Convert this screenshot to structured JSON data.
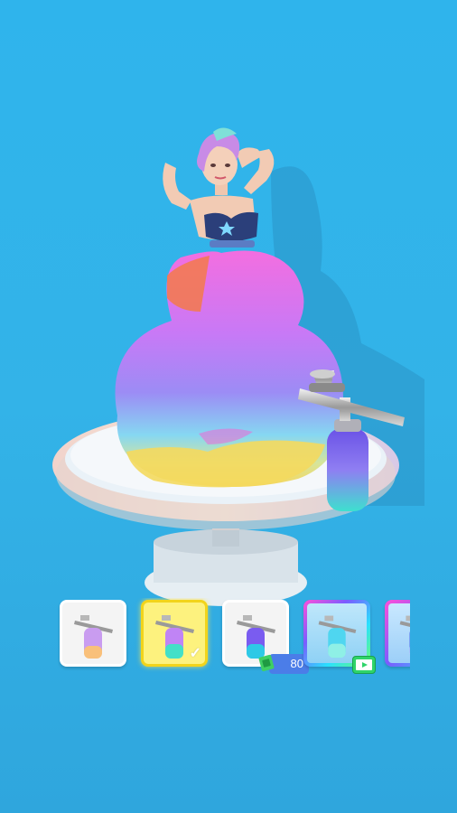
{
  "shop": {
    "items": [
      {
        "id": "spray-1",
        "state": "owned",
        "bottle_colors": [
          "#f9c07a",
          "#b97cf0"
        ]
      },
      {
        "id": "spray-2",
        "state": "selected",
        "bottle_colors": [
          "#c084f5",
          "#43e0c8"
        ]
      },
      {
        "id": "spray-3",
        "state": "locked",
        "price": "80",
        "bottle_colors": [
          "#7a5cf0",
          "#2ec9e6"
        ]
      },
      {
        "id": "spray-4",
        "state": "ad",
        "bottle_colors": [
          "#4fd6f0",
          "#8ff0e6"
        ]
      },
      {
        "id": "spray-5",
        "state": "ad",
        "bottle_colors": [
          "#6a8cf0",
          "#b3c6ff"
        ]
      }
    ]
  },
  "colors": {
    "background": "#32b1e8",
    "selected_slot": "#fdf27e",
    "price_badge": "#4b7de8",
    "video_badge": "#2fd46a"
  }
}
